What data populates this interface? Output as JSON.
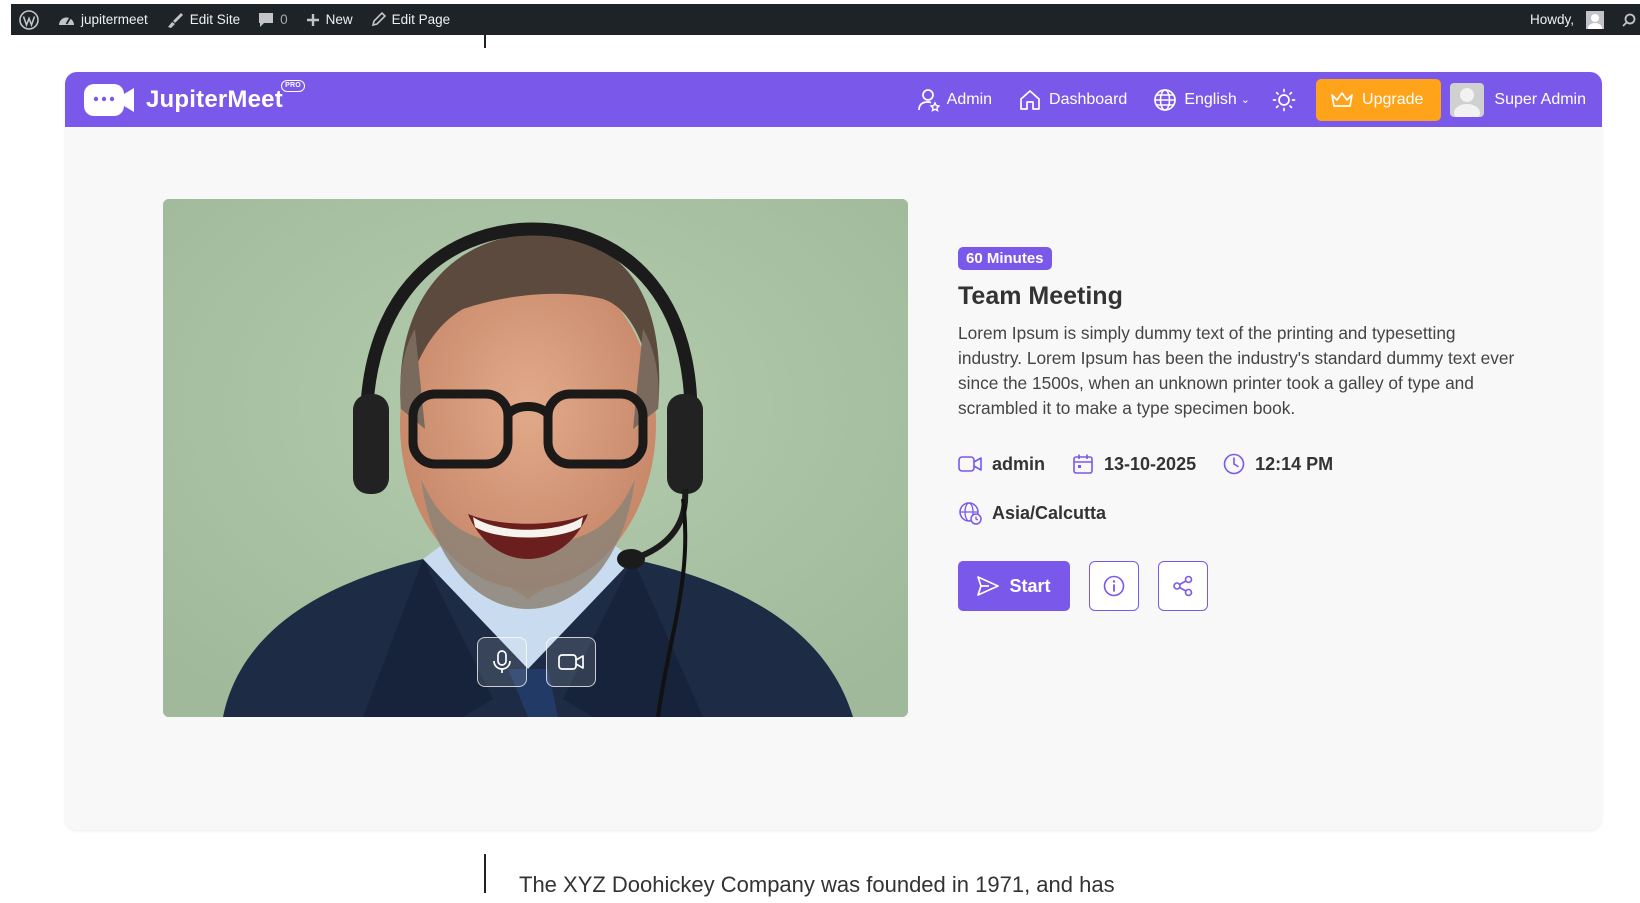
{
  "wp_bar": {
    "site_name": "jupitermeet",
    "edit_site": "Edit Site",
    "comments_count": "0",
    "new_label": "New",
    "edit_page": "Edit Page",
    "howdy": "Howdy,"
  },
  "app": {
    "brand_name": "JupiterMeet",
    "brand_badge": "PRO",
    "nav": {
      "admin": "Admin",
      "dashboard": "Dashboard",
      "language": "English",
      "upgrade": "Upgrade",
      "user_name": "Super Admin"
    },
    "meeting": {
      "duration_badge": "60 Minutes",
      "title": "Team Meeting",
      "description": "Lorem Ipsum is simply dummy text of the printing and typesetting industry. Lorem Ipsum has been the industry's standard dummy text ever since the 1500s, when an unknown printer took a galley of type and scrambled it to make a type specimen book.",
      "host": "admin",
      "date": "13-10-2025",
      "time": "12:14 PM",
      "timezone": "Asia/Calcutta",
      "start_label": "Start"
    }
  },
  "page_text": "The XYZ Doohickey Company was founded in 1971, and has",
  "colors": {
    "accent": "#7a58ea",
    "upgrade": "#ffa31a",
    "wp_bar": "#1d2327"
  }
}
